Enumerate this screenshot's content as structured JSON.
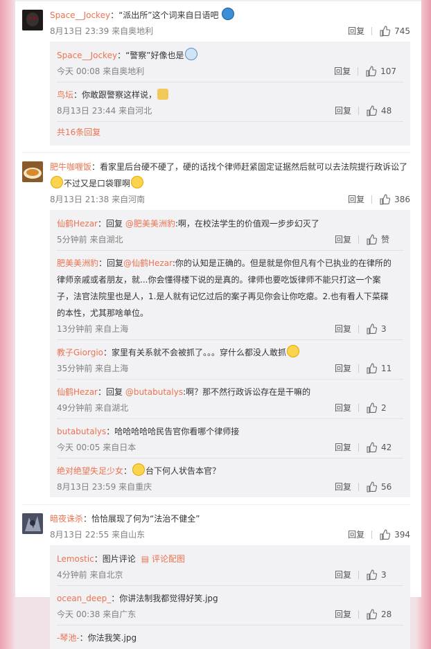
{
  "threads": [
    {
      "user": "Space__Jockey",
      "text": "：“派出所”这个词来自日语吧",
      "time": "8月13日 23:39 来自奥地利",
      "reply": "回复",
      "likes": "745",
      "subs": [
        {
          "user": "Space__Jockey",
          "text": "：“警察”好像也是",
          "time": "今天 00:08 来自奥地利",
          "reply": "回复",
          "likes": "107"
        },
        {
          "user": "鸟坛",
          "text": "：你敢跟警察这样说，",
          "time": "8月13日 23:44 来自河北",
          "reply": "回复",
          "likes": "48"
        }
      ],
      "more": "共16条回复"
    },
    {
      "user": "肥牛咖喱饭",
      "text": "：看家里后台硬不硬了，硬的话找个律师赶紧固定证据然后就可以去法院提行政诉讼了",
      "text2": "不过又是口袋罪啊",
      "time": "8月13日 21:38 来自河南",
      "reply": "回复",
      "likes": "386",
      "subs": [
        {
          "user": "仙鹤Hezar",
          "pre": "：回复 ",
          "mention": "@肥美美洲豹",
          "text": ":啊，在校法学生的价值观一步步幻灭了",
          "time": "5分钟前 来自湖北",
          "reply": "回复",
          "likes": "赞"
        },
        {
          "user": "肥美美洲豹",
          "pre": "：回复",
          "mention": "@仙鹤Hezar",
          "text": ":你的认知是正确的。但是就是你但凡有个已执业的在律所的律师亲戚或者朋友，就...你会懂得楼下说的是真的。律师也要吃饭律师不能只打这一个案子，法官法院里也是人，1.是人就有记忆过后的案子再见你会让你吃瘪。2.也有看人下菜碟的本性，尤其那啥单位。",
          "time": "13分钟前 来自上海",
          "reply": "回复",
          "likes": "3"
        },
        {
          "user": "教子Giorgio",
          "text": "：家里有关系就不会被抓了。。。穿什么都没人敢抓",
          "time": "35分钟前 来自上海",
          "reply": "回复",
          "likes": "11"
        },
        {
          "user": "仙鹤Hezar",
          "pre": "：回复 ",
          "mention": "@butabutalys",
          "text": ":啊？那不然行政诉讼存在是干嘛的",
          "time": "49分钟前 来自湖北",
          "reply": "回复",
          "likes": "2"
        },
        {
          "user": "butabutalys",
          "text": "：哈哈哈哈哈民告官你看哪个律师接",
          "time": "今天 00:05 来自日本",
          "reply": "回复",
          "likes": "42"
        },
        {
          "user": "绝对绝望失足少女",
          "text": "：",
          "text_after": "台下何人状告本官？",
          "time": "8月13日 23:59 来自重庆",
          "reply": "回复",
          "likes": "56"
        }
      ]
    },
    {
      "user": "暗夜诛杀",
      "text": "：恰恰展现了何为“法治不健全”",
      "time": "8月13日 22:55 来自山东",
      "reply": "回复",
      "likes": "394",
      "subs": [
        {
          "user": "Lemostic",
          "text": "：图片评论",
          "img_label": "评论配图",
          "time": "4分钟前 来自北京",
          "reply": "回复",
          "likes": "3"
        },
        {
          "user": "ocean_deep_",
          "text": "：你讲法制我都觉得好笑.jpg",
          "time": "今天 00:38 来自广东",
          "reply": "回复",
          "likes": "28"
        },
        {
          "user": "-琴池-",
          "text": "：你法我笑.jpg",
          "time": "",
          "reply": "",
          "likes": ""
        }
      ]
    }
  ],
  "colors": {
    "accent": "#eb7350",
    "meta": "#808080",
    "subbg": "#f2f2f5"
  },
  "icons": {
    "like": "thumbs-up-icon",
    "image": "image-icon"
  }
}
